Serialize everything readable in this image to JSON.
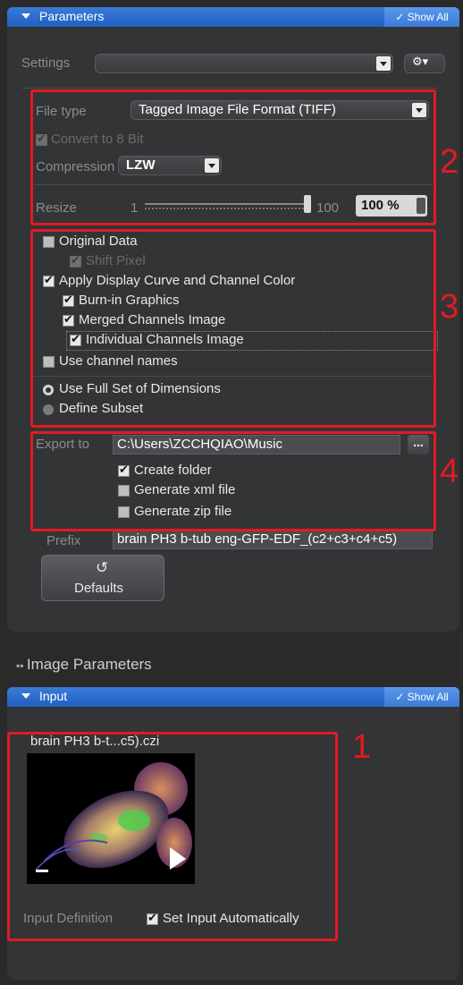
{
  "parameters": {
    "title": "Parameters",
    "show_all": "✓ Show All",
    "settings_label": "Settings",
    "settings_value": "",
    "gear": "⚙▾",
    "file_type_label": "File type",
    "file_type_value": "Tagged Image File Format (TIFF)",
    "convert_label": "Convert to 8 Bit",
    "compression_label": "Compression",
    "compression_value": "LZW",
    "resize_label": "Resize",
    "resize_min": "1",
    "resize_max": "100",
    "resize_value": "100 %",
    "resize_level": 1.0,
    "original_data": "Original Data",
    "shift_pixel": "Shift Pixel",
    "apply_display": "Apply Display Curve and Channel Color",
    "burn_in": "Burn-in Graphics",
    "merged": "Merged Channels Image",
    "individual": "Individual Channels Image",
    "use_channel_names": "Use channel names",
    "full_set": "Use Full Set of Dimensions",
    "define_subset": "Define Subset",
    "export_label": "Export to",
    "export_path": "C:\\Users\\ZCCHQIAO\\Music",
    "browse": "...",
    "create_folder": "Create folder",
    "gen_xml": "Generate xml file",
    "gen_zip": "Generate zip file",
    "prefix_label": "Prefix",
    "prefix_value": "brain PH3 b-tub eng-GFP-EDF_(c2+c3+c4+c5)",
    "defaults_icon": "↺",
    "defaults": "Defaults"
  },
  "image_parameters": {
    "title": "Image Parameters"
  },
  "input": {
    "title": "Input",
    "show_all": "✓ Show All",
    "file_name": "brain PH3 b-t...c5).czi",
    "input_definition": "Input Definition",
    "set_auto": "Set Input Automatically"
  },
  "annotations": [
    "2",
    "3",
    "4",
    "1"
  ],
  "colors": {
    "accent": "#2f6fd0",
    "highlight": "#e01b24",
    "panel": "#333436"
  }
}
